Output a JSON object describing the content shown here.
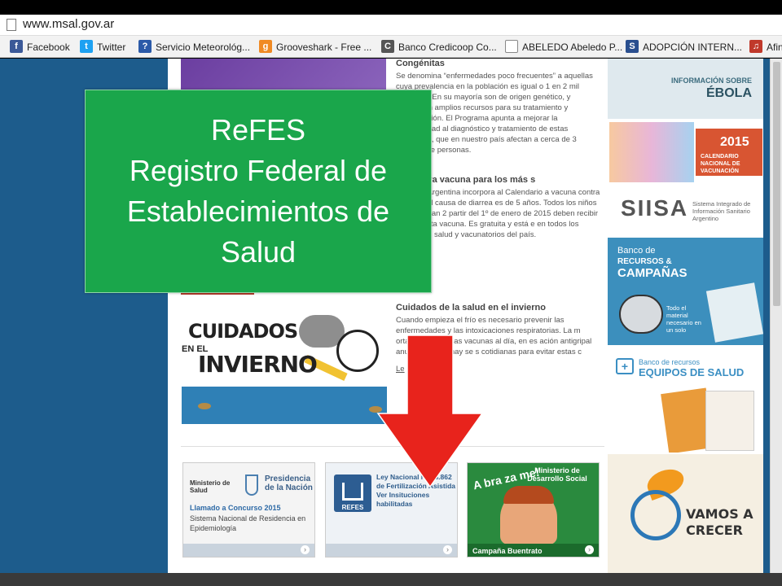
{
  "address_bar": {
    "url": "www.msal.gov.ar"
  },
  "bookmarks": [
    {
      "label": "Facebook",
      "icon": "facebook-icon",
      "color": "#3b5998",
      "glyph": "f"
    },
    {
      "label": "Twitter",
      "icon": "twitter-icon",
      "color": "#1da1f2",
      "glyph": "t"
    },
    {
      "label": "Servicio Meteorológ...",
      "icon": "weather-icon",
      "color": "#2b5aa8",
      "glyph": "?"
    },
    {
      "label": "Grooveshark - Free ...",
      "icon": "grooveshark-icon",
      "color": "#f08a24",
      "glyph": "g"
    },
    {
      "label": "Banco Credicoop Co...",
      "icon": "bank-icon",
      "color": "#555555",
      "glyph": "C"
    },
    {
      "label": "ABELEDO Abeledo P...",
      "icon": "page-icon",
      "color": "#ffffff",
      "glyph": ""
    },
    {
      "label": "ADOPCIÓN INTERN...",
      "icon": "s-icon",
      "color": "#2a4f8f",
      "glyph": "S"
    },
    {
      "label": "Afin",
      "icon": "music-icon",
      "color": "#c0392b",
      "glyph": "♫"
    }
  ],
  "overlay": {
    "line1": "ReFES",
    "line2": "Registro Federal de",
    "line3": "Establecimientos de",
    "line4": "Salud"
  },
  "content": {
    "sec1_title": "Congénitas",
    "sec1_text": "Se denomina “enfermedades poco frecuentes” a aquellas cuya prevalencia en la población es igual o 1 en 2 mil personas. En su mayoría son de origen genético, y demandan amplios recursos para su tratamiento y rehabilitación. El Programa apunta a mejorar la accesibilidad al diagnóstico y tratamiento de estas patologías, que en nuestro país afectan a cerca de 3 millones de personas.",
    "sec2_title": "as: nueva vacuna para los más s",
    "sec2_text": "este año Argentina incorpora al Calendario a vacuna contra la principal causa de diarrea es de 5 años. Todos los niños que cumplan 2 partir del 1º de enero de 2015 deben recibir osis de esta vacuna. Es gratuita y está e en todos los centros de salud y vacunatorios del país.",
    "sec3_title": "Cuidados de la salud en el invierno",
    "sec3_text": "Cuando empieza el frío es necesario prevenir las enfermedades y las intoxicaciones respiratorias. La m ortante es tener las vacunas al día, en es ación antigripal anual. También hay se s cotidianas para evitar estas c",
    "sec3_link": "Le",
    "art_title_1": "CUIDADOS",
    "art_title_2": "EN EL",
    "art_title_3": "INVIERNO"
  },
  "cards": {
    "c1_ministry": "Ministerio de Salud",
    "c1_presidency": "Presidencia de la Nación",
    "c1_call": "Llamado a Concurso 2015",
    "c1_desc": "Sistema Nacional de Residencia en Epidemiología",
    "c2_logo": "REFES",
    "c2_text": "Ley Nacional N° 26.862 de Fertilización Asistida Ver Insituciones habilitadas",
    "c3_head": "Ministerio de Desarrollo Social",
    "c3_abrazame": "A bra za me!",
    "c3_footer": "Campaña Buentrato"
  },
  "right": {
    "r1_small": "INFORMACIÓN SOBRE",
    "r1_big": "ÉBOLA",
    "r2_year": "2015",
    "r2_label": "CALENDARIO NACIONAL DE VACUNACIÓN",
    "r3_logo": "SIISA",
    "r3_sub": "Sistema Integrado de Información Sanitario Argentino",
    "r4_a": "Banco de",
    "r4_b": "RECURSOS &",
    "r4_c": "CAMPAÑAS",
    "r4_d": "Todo el material necesario en un solo",
    "r5_a": "Banco de recursos",
    "r5_b": "EQUIPOS DE SALUD",
    "r6_text": "VAMOS A CRECER"
  },
  "colors": {
    "overlay_green": "#1aa64b",
    "page_blue": "#1d5c8c",
    "arrow_red": "#e8231c"
  }
}
